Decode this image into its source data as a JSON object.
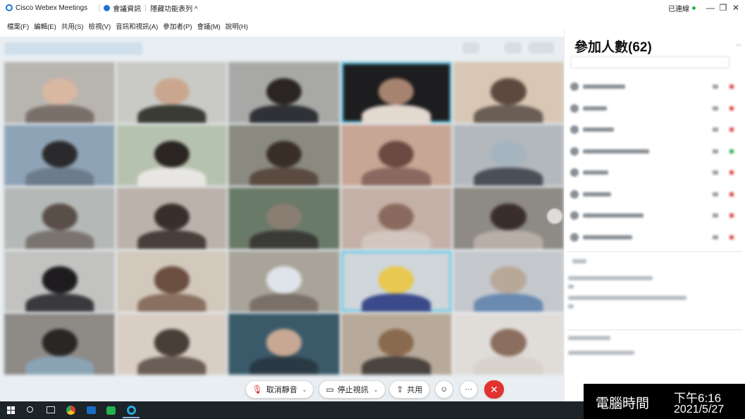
{
  "titlebar": {
    "app_name": "Cisco Webex Meetings",
    "meeting_info": "會議資訊",
    "hide_menu": "隱藏功能表列 ^",
    "connection": "已連線",
    "minimize": "—",
    "maximize": "❐",
    "close": "✕"
  },
  "menu": {
    "items": [
      "檔案(F)",
      "編輯(E)",
      "共用(S)",
      "檢視(V)",
      "音訊和視訊(A)",
      "參加者(P)",
      "會議(M)",
      "說明(H)"
    ]
  },
  "participants_panel": {
    "title": "參加人數(62)",
    "rows": 8
  },
  "controls": {
    "unmute": "取消靜音",
    "stop_video": "停止視訊",
    "share": "共用",
    "reactions_icon": "emoji-icon",
    "more": "···",
    "end": "✕"
  },
  "clock": {
    "label": "電腦時間",
    "time": "下午6:16",
    "date": "2021/5/27"
  },
  "colors": {
    "accent": "#1e73d9",
    "active_speaker": "#5bc3e6",
    "end_button": "#e2322f",
    "taskbar": "#1c2329"
  }
}
